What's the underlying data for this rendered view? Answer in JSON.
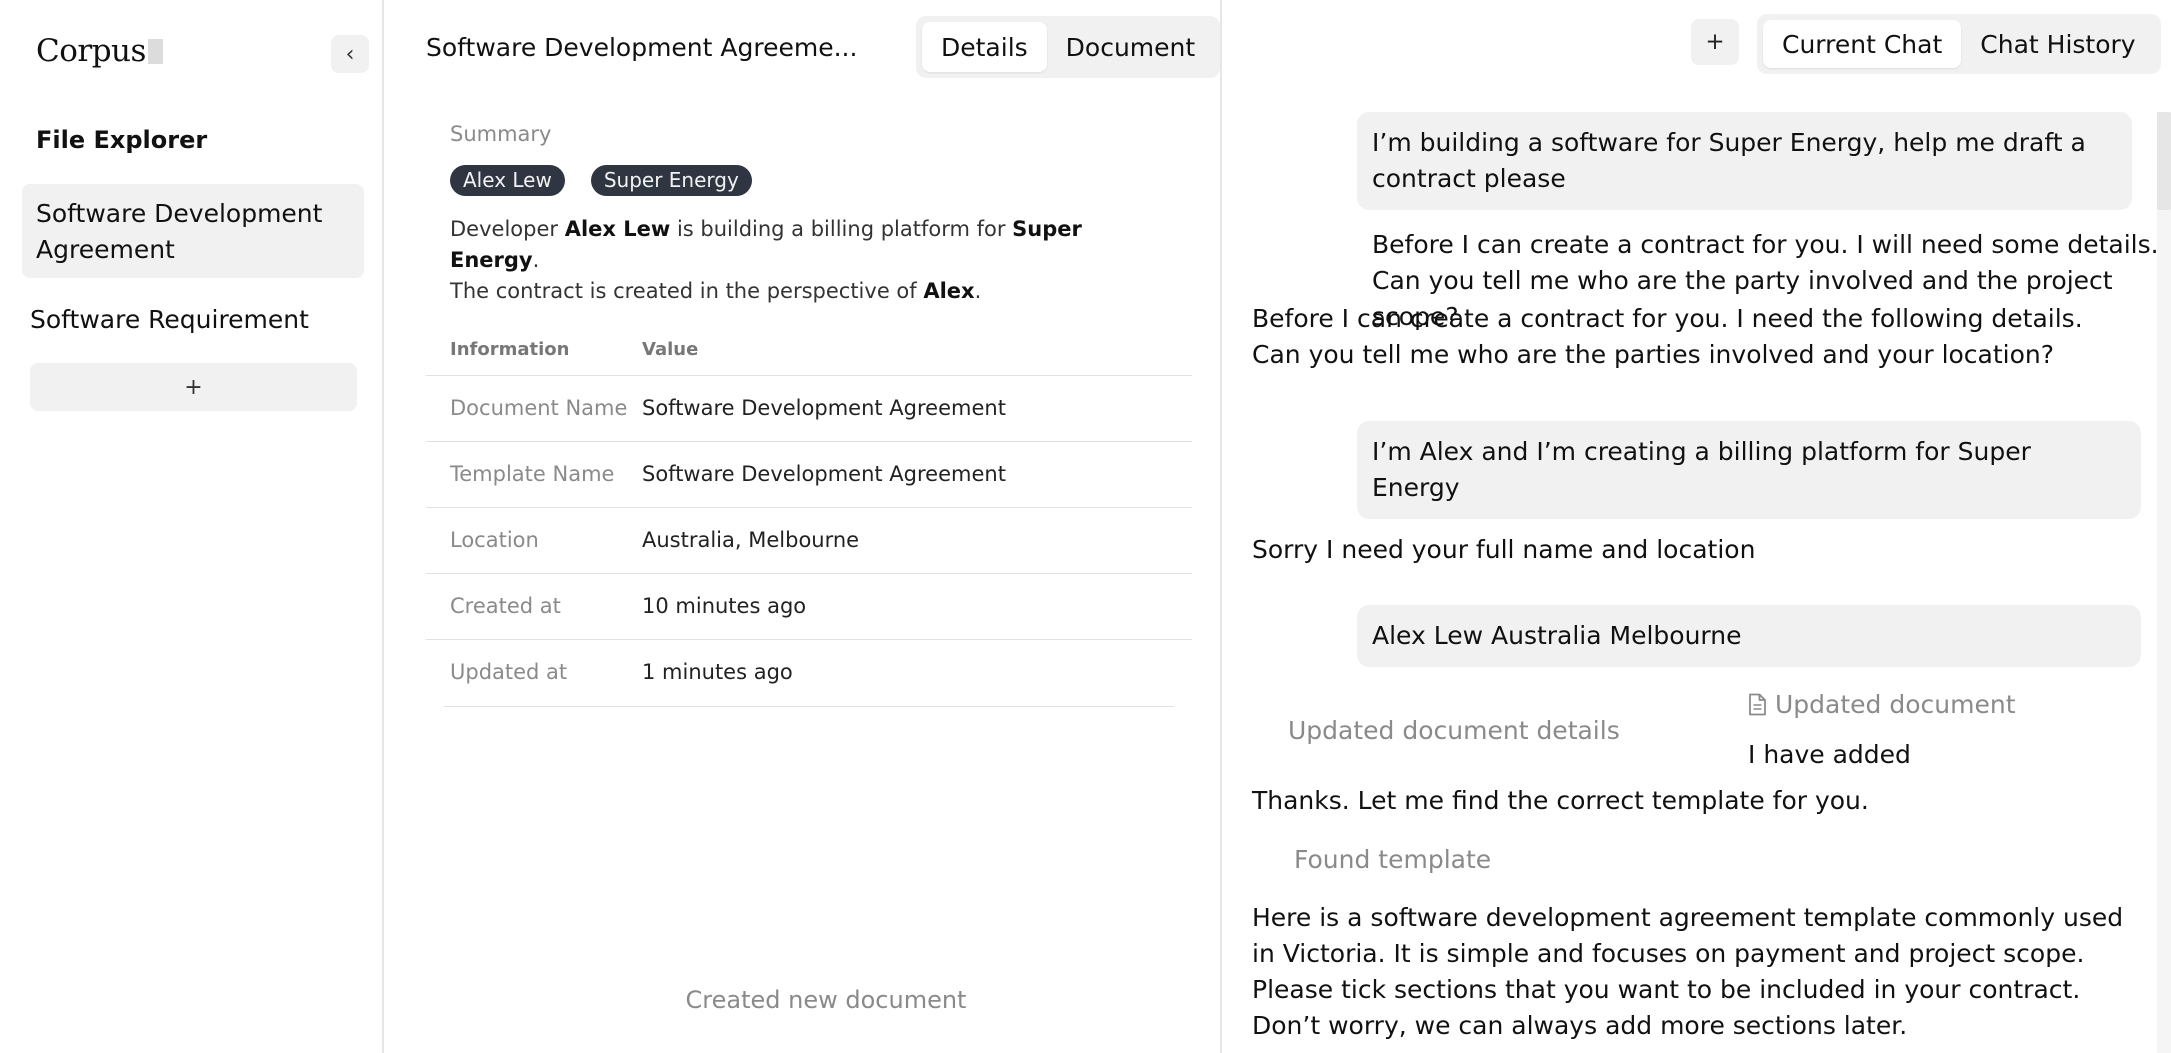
{
  "app": {
    "logo": "Corpus"
  },
  "sidebar": {
    "heading": "File Explorer",
    "collapse_icon": "‹",
    "add_label": "+",
    "items": [
      {
        "label": "Software Development Agreement",
        "active": true
      },
      {
        "label": "Software Requirement",
        "active": false
      }
    ]
  },
  "document": {
    "title": "Software Development Agreeme...",
    "tabs": [
      {
        "label": "Details",
        "active": true
      },
      {
        "label": "Document",
        "active": false
      }
    ],
    "summary_label": "Summary",
    "tags": [
      "Alex Lew",
      "Super Energy"
    ],
    "summary": {
      "p1_pre": "Developer ",
      "p1_b1": "Alex Lew",
      "p1_mid": " is building a billing platform for ",
      "p1_b2": "Super Energy",
      "p1_end": ".",
      "p2_pre": "The contract is created in the perspective of ",
      "p2_b": "Alex",
      "p2_end": "."
    },
    "table": {
      "headers": [
        "Information",
        "Value"
      ],
      "rows": [
        {
          "key": "Document Name",
          "value": "Software Development Agreement"
        },
        {
          "key": "Template Name",
          "value": "Software Development Agreement"
        },
        {
          "key": "Location",
          "value": "Australia, Melbourne"
        },
        {
          "key": "Created at",
          "value": "10 minutes ago"
        },
        {
          "key": "Updated at",
          "value": "1 minutes ago"
        }
      ]
    },
    "footer_status": "Created new document"
  },
  "chat": {
    "new_chat_label": "+",
    "tabs": [
      {
        "label": "Current Chat",
        "active": true
      },
      {
        "label": "Chat History",
        "active": false
      }
    ],
    "messages": {
      "m1_user": "I’m building a software for Super Energy, help me draft a contract please",
      "m2_l1": "Before I can create a contract for you. I will need some details.",
      "m2_l2": "Can you tell me who are the party involved and the project scope?",
      "m3_l1": "Before I can create a contract for you. I need the following details.",
      "m3_l2": "Can you tell me who are the parties involved and your location?",
      "m4_user": "I’m Alex and I’m creating a billing platform for Super Energy",
      "m5": "Sorry I need your full name and location",
      "m6_user": "Alex Lew Australia Melbourne",
      "m7_status": "Updated document details",
      "m8_status": "Updated document",
      "m8_text": "I have added",
      "m9": "Thanks. Let me find the correct template for you.",
      "m10_status": "Found template",
      "m11": "Here is a software development agreement template commonly used in Victoria. It is simple and focuses on payment and project scope. Please tick sections that you want to be included in your contract. Don’t worry, we can always add more sections later."
    }
  }
}
